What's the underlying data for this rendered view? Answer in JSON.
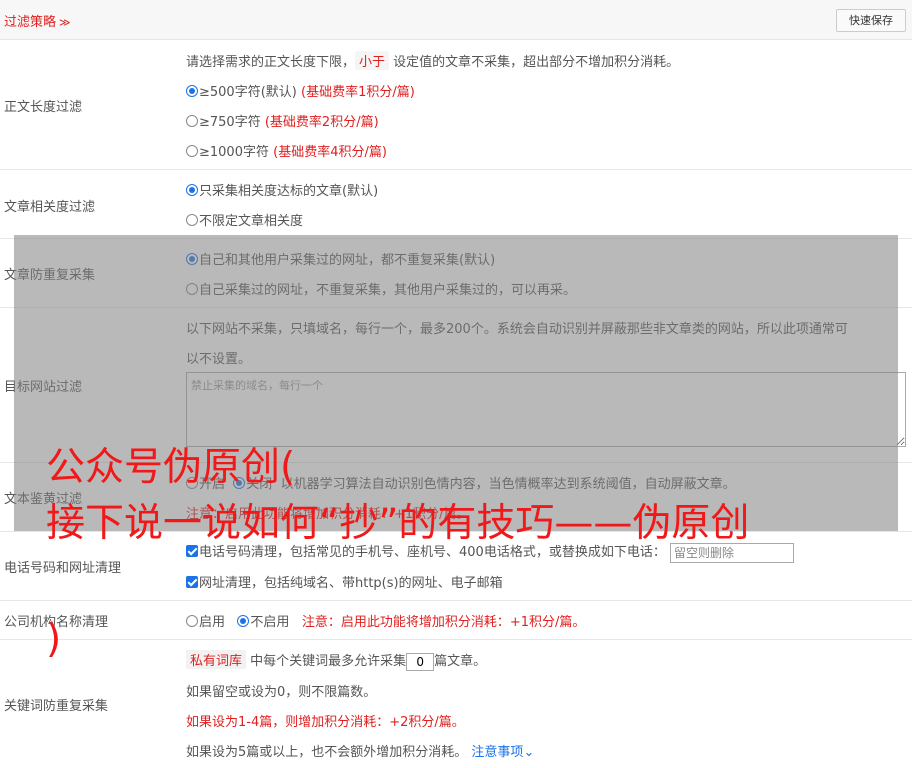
{
  "header": {
    "title": "过滤策略",
    "save_label": "快速保存"
  },
  "content_length": {
    "label": "正文长度过滤",
    "desc_before": "请选择需求的正文长度下限，",
    "desc_tag": "小于",
    "desc_after": "设定值的文章不采集，超出部分不增加积分消耗。",
    "options": [
      {
        "text": "≥500字符(默认)",
        "note": "(基础费率1积分/篇)",
        "checked": true
      },
      {
        "text": "≥750字符",
        "note": "(基础费率2积分/篇)",
        "checked": false
      },
      {
        "text": "≥1000字符",
        "note": "(基础费率4积分/篇)",
        "checked": false
      }
    ]
  },
  "relevance": {
    "label": "文章相关度过滤",
    "options": [
      {
        "text": "只采集相关度达标的文章(默认)",
        "checked": true
      },
      {
        "text": "不限定文章相关度",
        "checked": false
      }
    ]
  },
  "dedup": {
    "label": "文章防重复采集",
    "options": [
      {
        "text": "自己和其他用户采集过的网址，都不重复采集(默认)",
        "checked": true
      },
      {
        "text": "自己采集过的网址，不重复采集，其他用户采集过的，可以再采。",
        "checked": false
      }
    ]
  },
  "site_filter": {
    "label": "目标网站过滤",
    "desc_line1": "以下网站不采集，只填域名，每行一个，最多200个。系统会自动识别并屏蔽那些非文章类的网站，所以此项通常可",
    "desc_line2": "以不设置。",
    "placeholder": "禁止采集的域名，每行一个"
  },
  "text_review": {
    "label": "文本鉴黄过滤",
    "on_label": "开启",
    "off_label": "关闭",
    "desc": "以机器学习算法自动识别色情内容，当色情概率达到系统阈值，自动屏蔽文章。",
    "note": "注意：启用此功能将增加积分消耗：+1积分/篇。"
  },
  "phone_url": {
    "label": "电话号码和网址清理",
    "phone_text": "电话号码清理，包括常见的手机号、座机号、400电话格式，或替换成如下电话：",
    "phone_placeholder": "留空则删除",
    "url_text": "网址清理，包括纯域名、带http(s)的网址、电子邮箱"
  },
  "org_name": {
    "label": "公司机构名称清理",
    "on_label": "启用",
    "off_label": "不启用",
    "note": "注意：启用此功能将增加积分消耗：+1积分/篇。"
  },
  "keyword_dedup": {
    "label": "关键词防重复采集",
    "tag": "私有词库",
    "line1_before": "中每个关键词最多允许采集",
    "count": "0",
    "line1_after": "篇文章。",
    "line2": "如果留空或设为0，则不限篇数。",
    "line3": "如果设为1-4篇，则增加积分消耗：+2积分/篇。",
    "line4": "如果设为5篇或以上，也不会额外增加积分消耗。",
    "notice_link": "注意事项"
  },
  "watermark": {
    "line1": "公众号伪原创(",
    "line2": "接下说一说如何“抄”的有技巧——伪原创",
    "line3": ")"
  },
  "colors": {
    "accent_red": "#e02020",
    "link_blue": "#1a73e8",
    "overlay_gray": "#808080"
  }
}
